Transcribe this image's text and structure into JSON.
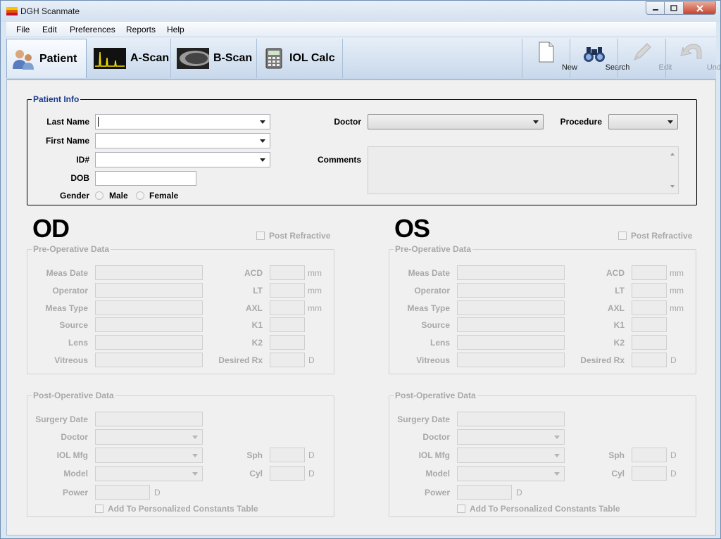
{
  "window": {
    "title": "DGH Scanmate"
  },
  "menu": [
    "File",
    "Edit",
    "Preferences",
    "Reports",
    "Help"
  ],
  "tabs": [
    {
      "label": "Patient",
      "icon": "patient-icon",
      "active": true
    },
    {
      "label": "A-Scan",
      "icon": "a-scan-icon"
    },
    {
      "label": "B-Scan",
      "icon": "b-scan-icon"
    },
    {
      "label": "IOL Calc",
      "icon": "calculator-icon"
    }
  ],
  "tools": [
    {
      "label": "New",
      "icon": "new-document-icon",
      "enabled": true
    },
    {
      "label": "Search",
      "icon": "binoculars-icon",
      "enabled": true
    },
    {
      "label": "Edit",
      "icon": "pencil-icon",
      "enabled": false
    },
    {
      "label": "Undo",
      "icon": "undo-arrow-icon",
      "enabled": false
    }
  ],
  "patient": {
    "legend": "Patient Info",
    "last_name_label": "Last Name",
    "first_name_label": "First Name",
    "id_label": "ID#",
    "dob_label": "DOB",
    "gender_label": "Gender",
    "male_label": "Male",
    "female_label": "Female",
    "doctor_label": "Doctor",
    "procedure_label": "Procedure",
    "comments_label": "Comments"
  },
  "od": {
    "title": "OD",
    "post_refractive": "Post Refractive",
    "pre_legend": "Pre-Operative Data",
    "post_legend": "Post-Operative Data"
  },
  "os": {
    "title": "OS",
    "post_refractive": "Post Refractive",
    "pre_legend": "Pre-Operative Data",
    "post_legend": "Post-Operative Data"
  },
  "pre_labels": {
    "meas_date": "Meas Date",
    "operator": "Operator",
    "meas_type": "Meas Type",
    "source": "Source",
    "lens": "Lens",
    "vitreous": "Vitreous",
    "acd": "ACD",
    "lt": "LT",
    "axl": "AXL",
    "k1": "K1",
    "k2": "K2",
    "desired_rx": "Desired Rx",
    "mm": "mm",
    "d": "D"
  },
  "post_labels": {
    "surgery_date": "Surgery Date",
    "doctor": "Doctor",
    "iol_mfg": "IOL Mfg",
    "model": "Model",
    "power": "Power",
    "sph": "Sph",
    "cyl": "Cyl",
    "d": "D",
    "personalized": "Add To Personalized Constants Table"
  }
}
